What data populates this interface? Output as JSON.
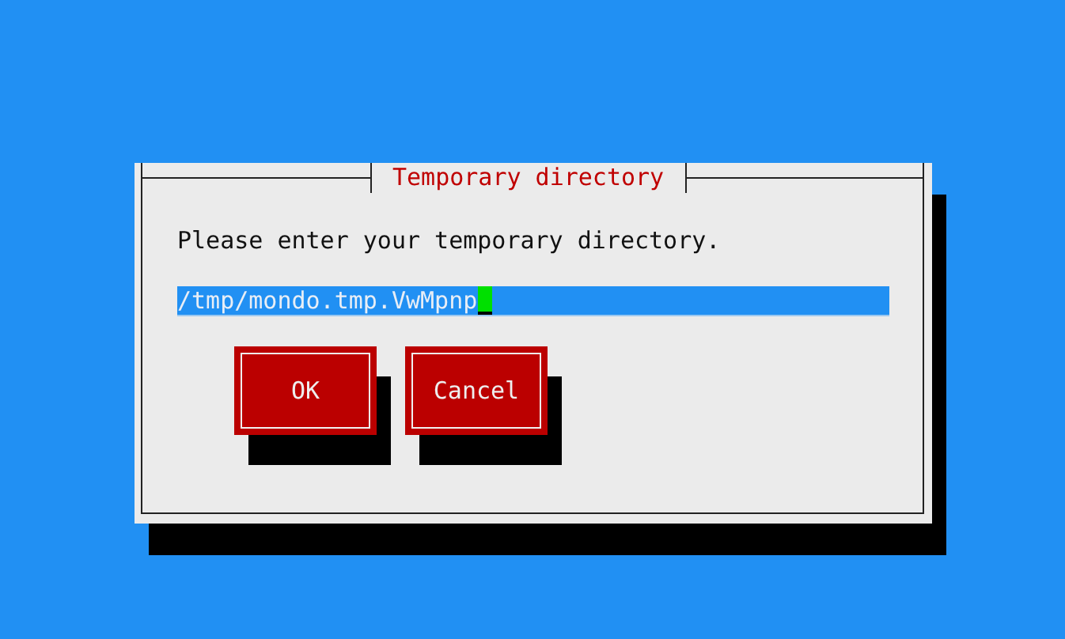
{
  "dialog": {
    "title": "Temporary directory",
    "prompt": "Please enter your temporary directory.",
    "field": {
      "value": "/tmp/mondo.tmp.VwMpnp",
      "focused": true
    },
    "buttons": [
      {
        "label": "OK"
      },
      {
        "label": "Cancel"
      }
    ]
  }
}
